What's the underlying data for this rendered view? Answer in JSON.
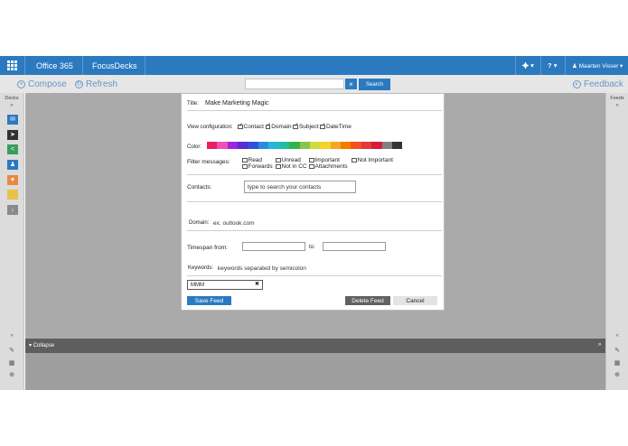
{
  "topbar": {
    "app_name": "Office 365",
    "module": "FocusDecks",
    "settings_caret": "▾",
    "help_label": "?",
    "help_caret": "▾",
    "user_name": "Maarten Visser",
    "user_caret": "▾"
  },
  "commands": {
    "compose": "Compose",
    "refresh": "Refresh",
    "search_value": "",
    "search_clear": "×",
    "search_button": "Search",
    "feedback": "Feedback"
  },
  "left_panel": {
    "label": "Decks",
    "expand": "»",
    "collapse": "«",
    "deck_icons": [
      {
        "name": "mail-icon",
        "color": "#2b7ac0",
        "glyph": "✉"
      },
      {
        "name": "send-icon",
        "color": "#333333",
        "glyph": "➤"
      },
      {
        "name": "share-icon",
        "color": "#3a9e5f",
        "glyph": "<"
      },
      {
        "name": "people-icon",
        "color": "#2b7ac0",
        "glyph": "♟"
      },
      {
        "name": "heart-icon",
        "color": "#e88a3e",
        "glyph": "♥"
      },
      {
        "name": "folder-icon",
        "color": "#e8c24a",
        "glyph": ""
      },
      {
        "name": "download-icon",
        "color": "#8a8a8a",
        "glyph": "↓"
      }
    ]
  },
  "right_panel": {
    "label": "Feeds",
    "expand": "»",
    "collapse": "«"
  },
  "bottom": {
    "collapse_label": "Collapse",
    "collapse_icon": "▾",
    "expand_icon": "»"
  },
  "dialog": {
    "title_label": "Title:",
    "title_value": "Make Marketing Magic",
    "view_label": "View configuration:",
    "view_options": [
      {
        "label": "Contact",
        "checked": true
      },
      {
        "label": "Domain",
        "checked": true
      },
      {
        "label": "Subject",
        "checked": true
      },
      {
        "label": "DateTime",
        "checked": true
      }
    ],
    "color_label": "Color:",
    "colors": [
      "#e91e63",
      "#f050b4",
      "#9c27e0",
      "#5b2bd6",
      "#2b55d6",
      "#2b8ae0",
      "#29b6d8",
      "#1fbf9c",
      "#31b54a",
      "#8bc34a",
      "#cddc39",
      "#f5d328",
      "#f5a623",
      "#f57c00",
      "#f4511e",
      "#e53935",
      "#d81b3a",
      "#808080",
      "#333333"
    ],
    "filter_label": "Filter messages:",
    "filter_row1": [
      "Read",
      "Unread",
      "Important",
      "Not Important"
    ],
    "filter_row2": [
      "Forwards",
      "Not in CC",
      "Attachments"
    ],
    "contacts_label": "Contacts:",
    "contacts_placeholder": "type to search your contacts",
    "domain_label": "Domain:",
    "domain_placeholder": "ex. outlook.com",
    "timespan_label": "Timespan from:",
    "timespan_to": "to:",
    "keywords_label": "Keywords:",
    "keywords_placeholder": "keywords separated by semicolon",
    "keyword_tag": "MMM",
    "keyword_tag_remove": "✖",
    "save_button": "Save Feed",
    "delete_button": "Delete Feed",
    "cancel_button": "Cancel"
  },
  "colors": {
    "brand_blue": "#2b7ac0",
    "delete_gray": "#616161",
    "cancel_gray": "#e3e3e3"
  }
}
